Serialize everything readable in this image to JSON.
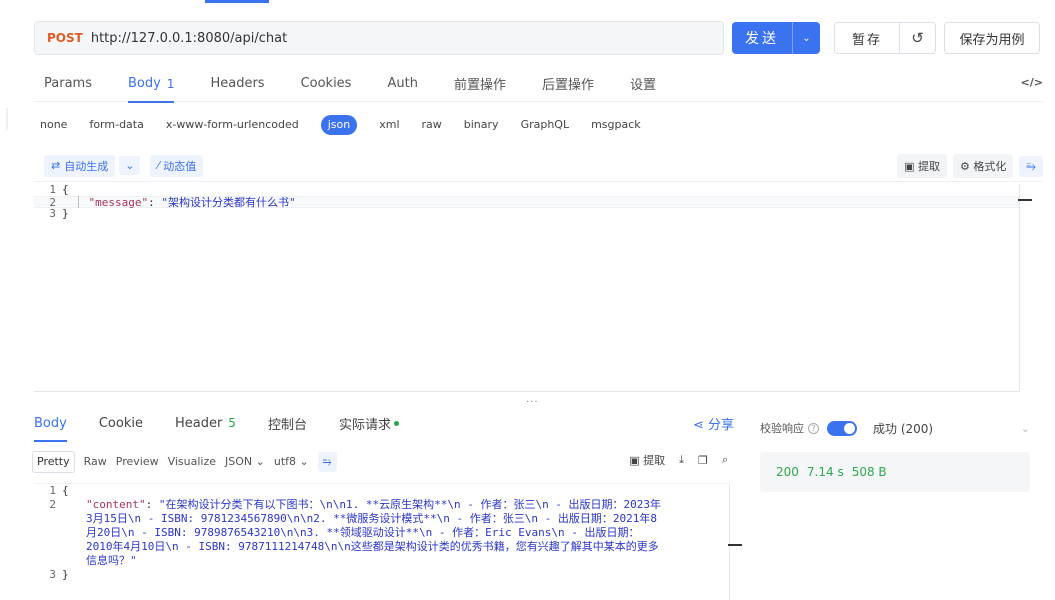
{
  "request": {
    "method": "POST",
    "url": "http://127.0.0.1:8080/api/chat",
    "send_label": "发送",
    "save_label": "暂存",
    "save_case_label": "保存为用例"
  },
  "request_tabs": [
    {
      "label": "Params"
    },
    {
      "label": "Body",
      "count": "1"
    },
    {
      "label": "Headers"
    },
    {
      "label": "Cookies"
    },
    {
      "label": "Auth"
    },
    {
      "label": "前置操作"
    },
    {
      "label": "后置操作"
    },
    {
      "label": "设置"
    }
  ],
  "body_types": [
    "none",
    "form-data",
    "x-www-form-urlencoded",
    "json",
    "xml",
    "raw",
    "binary",
    "GraphQL",
    "msgpack"
  ],
  "editor_toolbar": {
    "autogen": "自动生成",
    "dynamic": "动态值",
    "extract": "提取",
    "format": "格式化"
  },
  "request_body": {
    "lines": [
      "1",
      "2",
      "3"
    ],
    "open_brace": "{",
    "key": "\"message\"",
    "colon": ": ",
    "value": "\"架构设计分类都有什么书\"",
    "close_brace": "}"
  },
  "splitter": "...",
  "response_tabs": [
    {
      "label": "Body"
    },
    {
      "label": "Cookie"
    },
    {
      "label": "Header",
      "count": "5"
    },
    {
      "label": "控制台"
    },
    {
      "label": "实际请求"
    }
  ],
  "share_label": "分享",
  "response_views": [
    "Pretty",
    "Raw",
    "Preview",
    "Visualize",
    "JSON",
    "utf8"
  ],
  "response_view_right": {
    "extract": "提取"
  },
  "response_body": {
    "lines": [
      "1",
      "2",
      "3"
    ],
    "open_brace": "{",
    "key": "\"content\"",
    "colon": ": ",
    "value": "\"在架构设计分类下有以下图书：\\n\\n1. **云原生架构**\\n   - 作者：张三\\n   - 出版日期：2023年3月15日\\n   - ISBN: 9781234567890\\n\\n2. **微服务设计模式**\\n   - 作者：张三\\n   - 出版日期：2021年8月20日\\n   - ISBN: 9789876543210\\n\\n3. **领域驱动设计**\\n   - 作者：Eric Evans\\n   - 出版日期：2010年4月10日\\n   - ISBN: 9787111214748\\n\\n这些都是架构设计类的优秀书籍，您有兴趣了解其中某本的更多信息吗？\"",
    "close_brace": "}"
  },
  "validation": {
    "label": "校验响应",
    "result": "成功 (200)"
  },
  "stats": {
    "status": "200",
    "time": "7.14 s",
    "size": "508 B"
  },
  "colors": {
    "accent": "#3b72ef",
    "method": "#e05a28",
    "success": "#27a844"
  }
}
